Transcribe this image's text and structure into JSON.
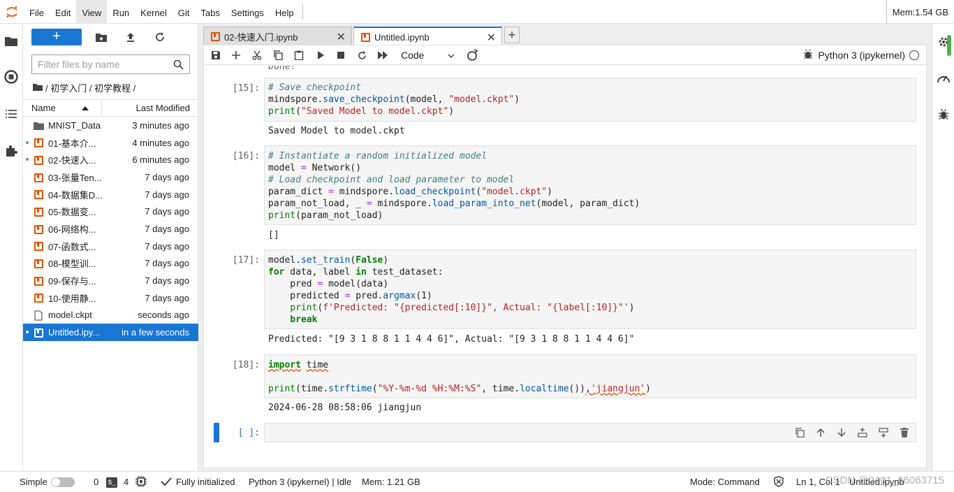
{
  "menu": {
    "items": [
      "File",
      "Edit",
      "View",
      "Run",
      "Kernel",
      "Git",
      "Tabs",
      "Settings",
      "Help"
    ],
    "active": "View",
    "memory": "Mem:1.54 GB"
  },
  "filebrowser": {
    "new_label": "+",
    "search_placeholder": "Filter files by name",
    "breadcrumb": "/ 初学入门 / 初学教程 /",
    "col_name": "Name",
    "col_modified": "Last Modified",
    "files": [
      {
        "name": "MNIST_Data",
        "modified": "3 minutes ago",
        "type": "folder",
        "running": false
      },
      {
        "name": "01-基本介...",
        "modified": "4 minutes ago",
        "type": "notebook",
        "running": true
      },
      {
        "name": "02-快速入...",
        "modified": "6 minutes ago",
        "type": "notebook",
        "running": true
      },
      {
        "name": "03-张量Ten...",
        "modified": "7 days ago",
        "type": "notebook",
        "running": false
      },
      {
        "name": "04-数据集D...",
        "modified": "7 days ago",
        "type": "notebook",
        "running": false
      },
      {
        "name": "05-数据变...",
        "modified": "7 days ago",
        "type": "notebook",
        "running": false
      },
      {
        "name": "06-网络构...",
        "modified": "7 days ago",
        "type": "notebook",
        "running": false
      },
      {
        "name": "07-函数式...",
        "modified": "7 days ago",
        "type": "notebook",
        "running": false
      },
      {
        "name": "08-模型训...",
        "modified": "7 days ago",
        "type": "notebook",
        "running": false
      },
      {
        "name": "09-保存与...",
        "modified": "7 days ago",
        "type": "notebook",
        "running": false
      },
      {
        "name": "10-使用静...",
        "modified": "7 days ago",
        "type": "notebook",
        "running": false
      },
      {
        "name": "model.ckpt",
        "modified": "seconds ago",
        "type": "file",
        "running": false
      },
      {
        "name": "Untitled.ipy...",
        "modified": "in a few seconds",
        "type": "notebook",
        "running": true,
        "selected": true
      }
    ]
  },
  "tabs": [
    {
      "label": "02-快速入门.ipynb",
      "active": false
    },
    {
      "label": "Untitled.ipynb",
      "active": true
    }
  ],
  "toolbar": {
    "cell_type": "Code",
    "kernel": "Python 3 (ipykernel)"
  },
  "notebook": {
    "prev_output_tail": "Done!",
    "cells": [
      {
        "prompt": "[15]:",
        "code": [
          "# Save checkpoint",
          "mindspore.save_checkpoint(model, \"model.ckpt\")",
          "print(\"Saved Model to model.ckpt\")"
        ],
        "output": [
          "Saved Model to model.ckpt"
        ]
      },
      {
        "prompt": "[16]:",
        "code": [
          "# Instantiate a random initialized model",
          "model = Network()",
          "# Load checkpoint and load parameter to model",
          "param_dict = mindspore.load_checkpoint(\"model.ckpt\")",
          "param_not_load, _ = mindspore.load_param_into_net(model, param_dict)",
          "print(param_not_load)"
        ],
        "output": [
          "[]"
        ]
      },
      {
        "prompt": "[17]:",
        "code": [
          "model.set_train(False)",
          "for data, label in test_dataset:",
          "    pred = model(data)",
          "    predicted = pred.argmax(1)",
          "    print(f'Predicted: \"{predicted[:10]}\", Actual: \"{label[:10]}\"')",
          "    break"
        ],
        "output": [
          "Predicted: \"[9 3 1 8 8 1 1 4 4 6]\", Actual: \"[9 3 1 8 8 1 1 4 4 6]\""
        ]
      },
      {
        "prompt": "[18]:",
        "code": [
          "import time",
          "",
          "print(time.strftime(\"%Y-%m-%d %H:%M:%S\", time.localtime()),'jiangjun')"
        ],
        "output": [
          "2024-06-28 08:58:06 jiangjun"
        ]
      },
      {
        "prompt": "[ ]:",
        "code": [],
        "output": []
      }
    ]
  },
  "status": {
    "mode_label": "Simple",
    "terminals": "0",
    "kernels": "4",
    "init": "Fully initialized",
    "kernel_state": "Python 3 (ipykernel) | Idle",
    "mem": "Mem: 1.21 GB",
    "mode": "Mode: Command",
    "position": "Ln 1, Col 1",
    "file": "Untitled.ipynb",
    "watermark": "CSDN @2401_86063715"
  }
}
